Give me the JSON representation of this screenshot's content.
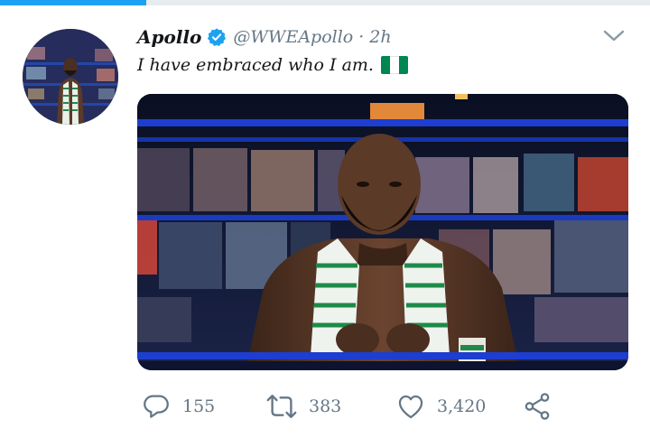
{
  "tweet": {
    "author_name": "Apollo",
    "handle": "@WWEApollo",
    "separator": "·",
    "time": "2h",
    "text": "I have embraced who I am.",
    "flag_colors": [
      "#008751",
      "#ffffff",
      "#008751"
    ]
  },
  "actions": {
    "replies": "155",
    "retweets": "383",
    "likes": "3,420"
  },
  "colors": {
    "accent": "#1da1f2",
    "secondary_text": "#657786",
    "icon": "#657786"
  }
}
